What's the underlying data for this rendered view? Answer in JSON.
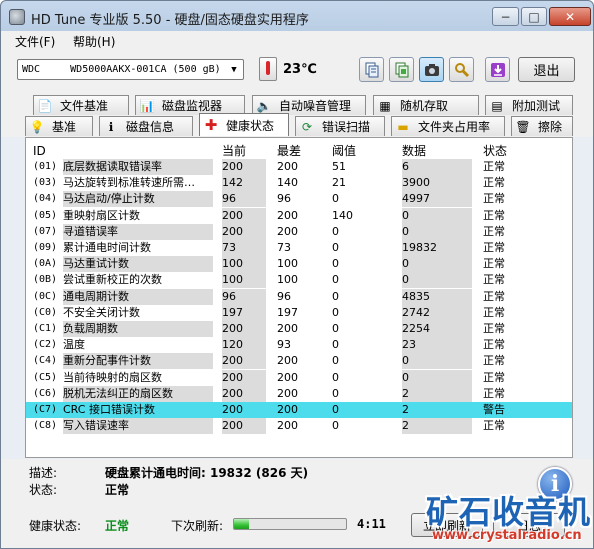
{
  "window": {
    "title": "HD Tune 专业版 5.50 - 硬盘/固态硬盘实用程序",
    "controls": {
      "minimize": "−",
      "maximize": "□",
      "close": "✕"
    }
  },
  "menu": {
    "file": "文件(F)",
    "help": "帮助(H)"
  },
  "toolbar": {
    "drive": "WDC     WD5000AAKX-001CA (500 gB)",
    "temperature": "23℃",
    "exit_label": "退出",
    "buttons": [
      "copy-text-icon",
      "copy-screen-icon",
      "camera-icon",
      "options-icon",
      "save-down-icon"
    ]
  },
  "tabs": {
    "row1": [
      "文件基准",
      "磁盘监视器",
      "自动噪音管理",
      "随机存取",
      "附加测试"
    ],
    "row2": [
      "基准",
      "磁盘信息",
      "健康状态",
      "错误扫描",
      "文件夹占用率",
      "擦除"
    ],
    "selected": "健康状态"
  },
  "table": {
    "headers": {
      "id": "ID",
      "current": "当前",
      "worst": "最差",
      "threshold": "阈值",
      "data": "数据",
      "status": "状态"
    },
    "rows": [
      {
        "id": "(01)",
        "name": "底层数据读取错误率",
        "current": "200",
        "worst": "200",
        "threshold": "51",
        "data": "6",
        "status": "正常"
      },
      {
        "id": "(03)",
        "name": "马达旋转到标准转速所需…",
        "current": "142",
        "worst": "140",
        "threshold": "21",
        "data": "3900",
        "status": "正常"
      },
      {
        "id": "(04)",
        "name": "马达启动/停止计数",
        "current": "96",
        "worst": "96",
        "threshold": "0",
        "data": "4997",
        "status": "正常"
      },
      {
        "id": "(05)",
        "name": "重映射扇区计数",
        "current": "200",
        "worst": "200",
        "threshold": "140",
        "data": "0",
        "status": "正常"
      },
      {
        "id": "(07)",
        "name": "寻道错误率",
        "current": "200",
        "worst": "200",
        "threshold": "0",
        "data": "0",
        "status": "正常"
      },
      {
        "id": "(09)",
        "name": "累计通电时间计数",
        "current": "73",
        "worst": "73",
        "threshold": "0",
        "data": "19832",
        "status": "正常"
      },
      {
        "id": "(0A)",
        "name": "马达重试计数",
        "current": "100",
        "worst": "100",
        "threshold": "0",
        "data": "0",
        "status": "正常"
      },
      {
        "id": "(0B)",
        "name": "尝试重新校正的次数",
        "current": "100",
        "worst": "100",
        "threshold": "0",
        "data": "0",
        "status": "正常"
      },
      {
        "id": "(0C)",
        "name": "通电周期计数",
        "current": "96",
        "worst": "96",
        "threshold": "0",
        "data": "4835",
        "status": "正常"
      },
      {
        "id": "(C0)",
        "name": "不安全关闭计数",
        "current": "197",
        "worst": "197",
        "threshold": "0",
        "data": "2742",
        "status": "正常"
      },
      {
        "id": "(C1)",
        "name": "负载周期数",
        "current": "200",
        "worst": "200",
        "threshold": "0",
        "data": "2254",
        "status": "正常"
      },
      {
        "id": "(C2)",
        "name": "温度",
        "current": "120",
        "worst": "93",
        "threshold": "0",
        "data": "23",
        "status": "正常"
      },
      {
        "id": "(C4)",
        "name": "重新分配事件计数",
        "current": "200",
        "worst": "200",
        "threshold": "0",
        "data": "0",
        "status": "正常"
      },
      {
        "id": "(C5)",
        "name": "当前待映射的扇区数",
        "current": "200",
        "worst": "200",
        "threshold": "0",
        "data": "0",
        "status": "正常"
      },
      {
        "id": "(C6)",
        "name": "脱机无法纠正的扇区数",
        "current": "200",
        "worst": "200",
        "threshold": "0",
        "data": "2",
        "status": "正常"
      },
      {
        "id": "(C7)",
        "name": "CRC 接口错误计数",
        "current": "200",
        "worst": "200",
        "threshold": "0",
        "data": "2",
        "status": "警告"
      },
      {
        "id": "(C8)",
        "name": "写入错误速率",
        "current": "200",
        "worst": "200",
        "threshold": "0",
        "data": "2",
        "status": "正常"
      }
    ],
    "highlight_color": "#4ddcec"
  },
  "description": {
    "desc_label": "描述:",
    "desc_value": "硬盘累计通电时间: 19832 (826 天)",
    "state_label": "状态:",
    "state_value": "正常"
  },
  "footer": {
    "health_label": "健康状态:",
    "health_value": "正常",
    "health_color": "#0a8f1c",
    "refresh_label": "下次刷新:",
    "refresh_progress": 0.13,
    "timer": "4:11",
    "refresh_button": "立即刷新",
    "log_button": "日志"
  },
  "watermark": {
    "text": "矿石收音机",
    "url": "www.crystalradio.cn"
  }
}
